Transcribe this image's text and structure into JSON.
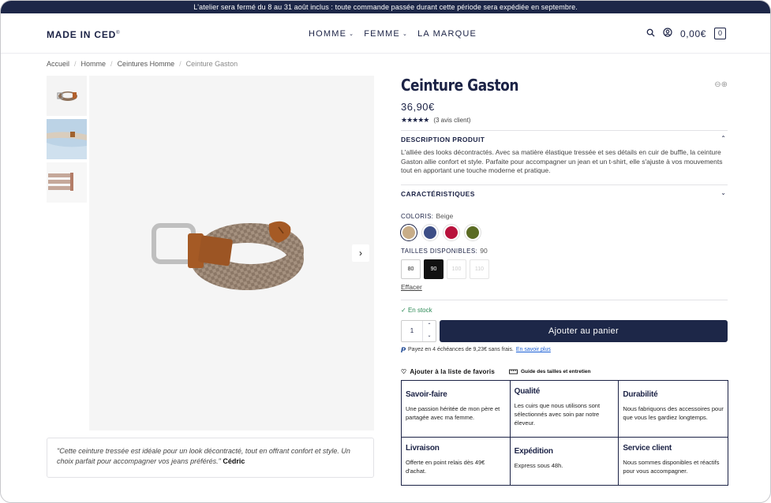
{
  "announcement": "L'atelier sera fermé du 8 au 31 août inclus : toute commande passée durant cette période sera expédiée en septembre.",
  "header": {
    "logo": "MADE IN CED",
    "logo_mark": "®",
    "nav": [
      {
        "label": "HOMME",
        "has_dropdown": true
      },
      {
        "label": "FEMME",
        "has_dropdown": true
      },
      {
        "label": "LA MARQUE",
        "has_dropdown": false
      }
    ],
    "cart_total": "0,00€",
    "cart_count": "0",
    "icons": [
      "search-icon",
      "account-icon",
      "cart-icon"
    ]
  },
  "breadcrumb": [
    "Accueil",
    "Homme",
    "Ceintures Homme",
    "Ceinture Gaston"
  ],
  "product": {
    "title": "Ceinture Gaston",
    "price": "36,90€",
    "stars": "★★★★★",
    "reviews": "(3 avis client)",
    "description_title": "DESCRIPTION PRODUIT",
    "description": "L'alliée des looks décontractés. Avec sa matière élastique tressée et ses détails en cuir de buffle, la ceinture Gaston allie confort et style. Parfaite pour accompagner un jean et un t-shirt, elle s'ajuste à vos mouvements tout en apportant une touche moderne et pratique.",
    "characteristics_title": "CARACTÉRISTIQUES",
    "color_label": "COLORIS:",
    "color_value": "Beige",
    "colors": [
      {
        "name": "Beige",
        "hex": "#c8ad88",
        "selected": true
      },
      {
        "name": "Bleu",
        "hex": "#3d4e86",
        "selected": false
      },
      {
        "name": "Rouge",
        "hex": "#b8123c",
        "selected": false
      },
      {
        "name": "Kaki",
        "hex": "#5a6b23",
        "selected": false
      }
    ],
    "size_label": "TAILLES DISPONIBLES:",
    "size_value": "90",
    "sizes": [
      {
        "label": "80",
        "state": "available"
      },
      {
        "label": "90",
        "state": "selected"
      },
      {
        "label": "100",
        "state": "unavailable"
      },
      {
        "label": "110",
        "state": "unavailable"
      }
    ],
    "clear_label": "Effacer",
    "stock": "En stock",
    "stock_icon": "✓",
    "quantity": "1",
    "add_to_cart": "Ajouter au panier",
    "paypal_text": "Payez en 4 échéances de 9,23€ sans frais.",
    "paypal_link": "En savoir plus",
    "wishlist": "Ajouter à la liste de favoris",
    "guide": "Guide des tailles et entretien"
  },
  "quote": {
    "text": "\"Cette ceinture tressée est idéale pour un look décontracté, tout en offrant confort et style. Un choix parfait pour accompagner vos jeans préférés.\"",
    "author": "Cédric"
  },
  "features": [
    {
      "title": "Savoir-faire",
      "text": "Une passion héritée de mon père et partagée avec ma femme."
    },
    {
      "title": "Qualité",
      "text": "Les cuirs que nous utilisons sont sélectionnés avec soin par notre éleveur."
    },
    {
      "title": "Durabilité",
      "text": "Nous fabriquons des accessoires pour que vous les gardiez longtemps."
    },
    {
      "title": "Livraison",
      "text": "Offerte en point relais dès 49€ d'achat."
    },
    {
      "title": "Expédition",
      "text": "Express sous 48h."
    },
    {
      "title": "Service client",
      "text": "Nous sommes disponibles et réactifs pour vous accompagner."
    }
  ]
}
